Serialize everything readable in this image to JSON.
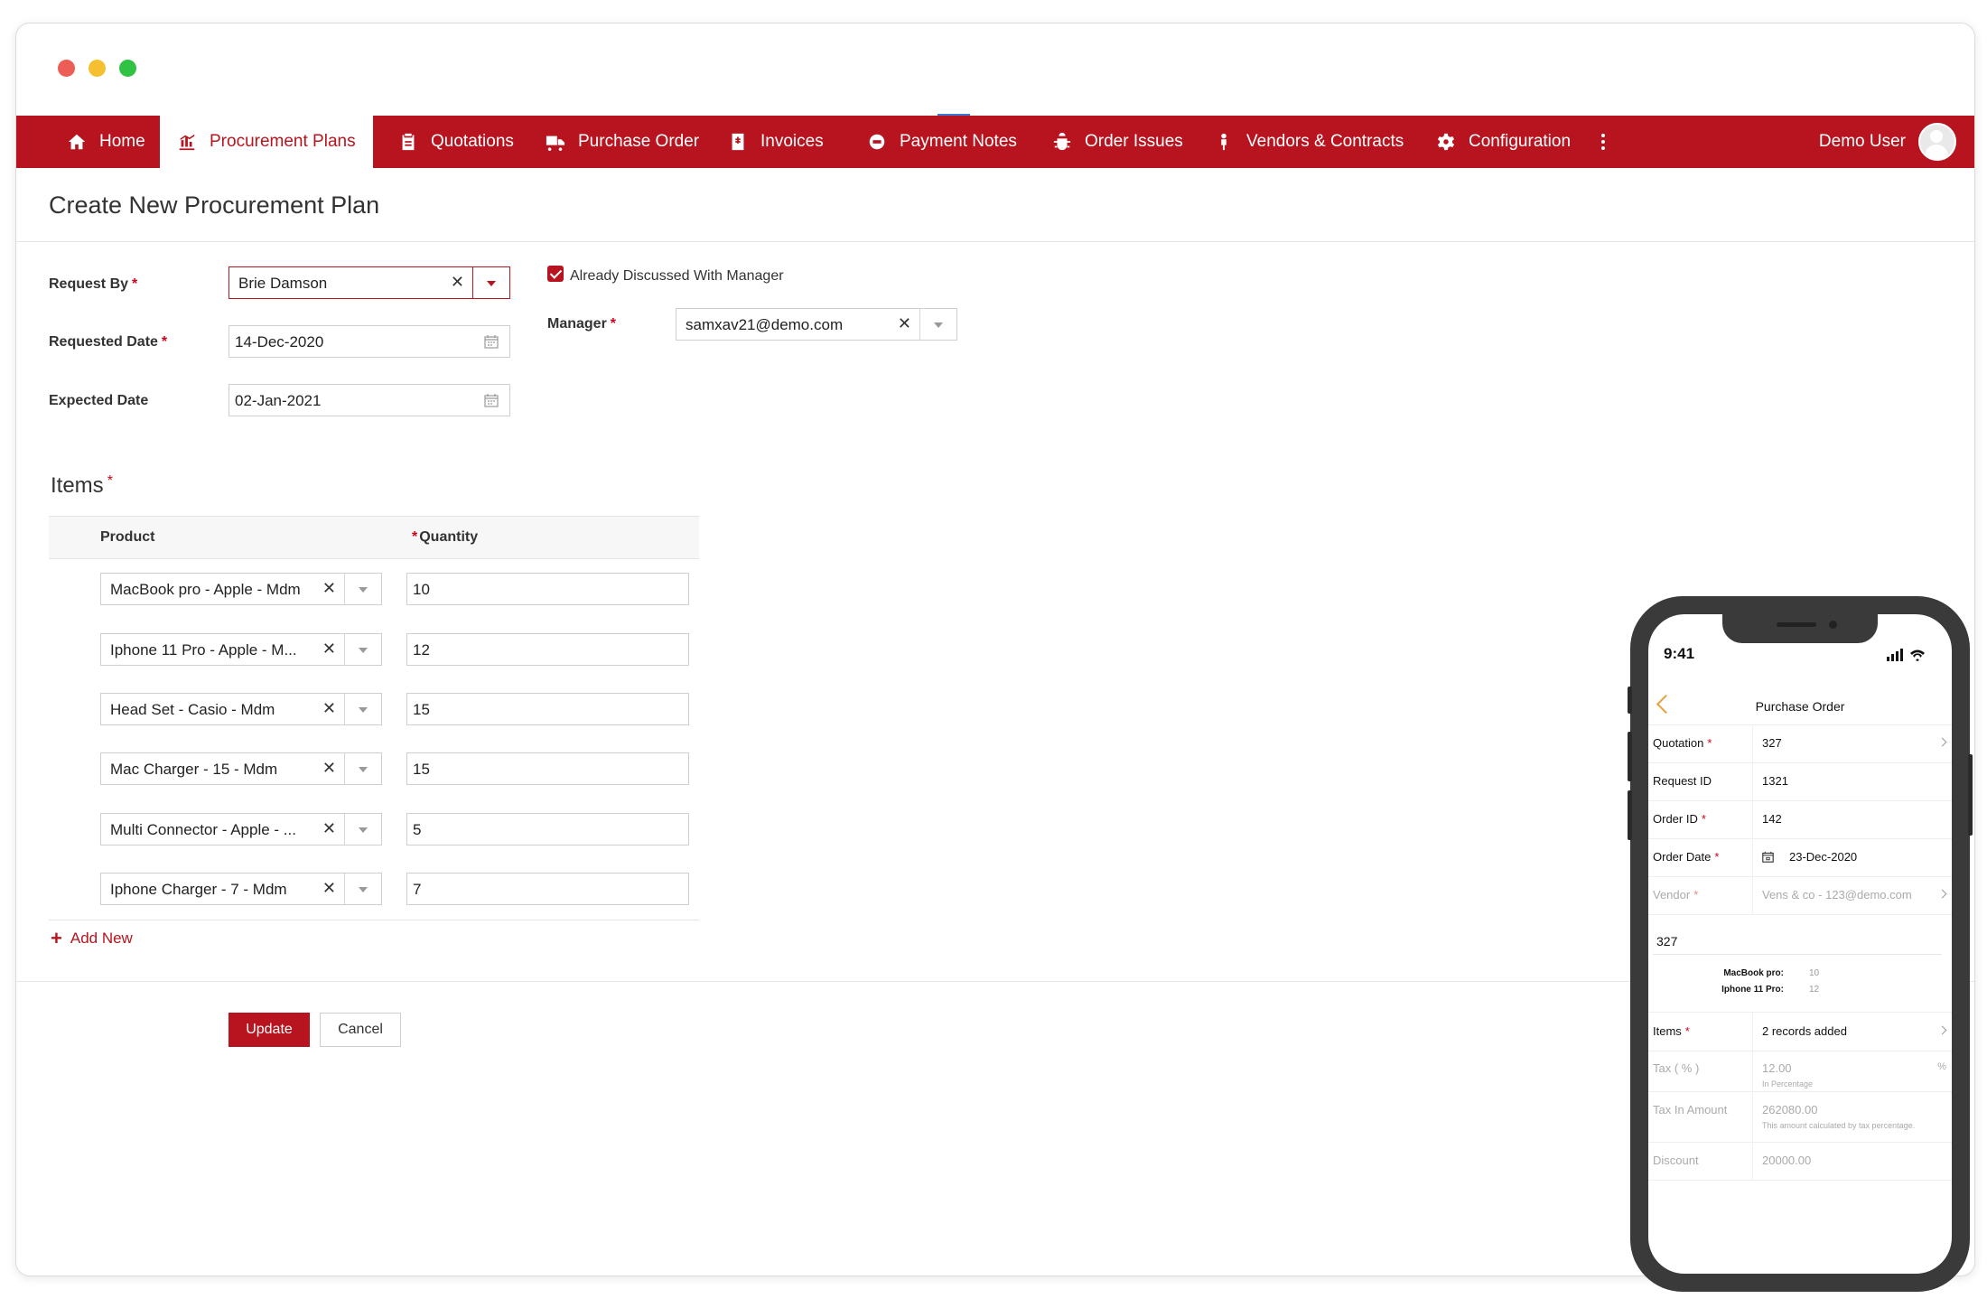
{
  "window": {
    "traffic_lights": [
      "#ed5d56",
      "#f5bf2f",
      "#31c244"
    ]
  },
  "colors": {
    "brand": "#b8141f",
    "accent_phone": "#e8a13a"
  },
  "nav": {
    "items": [
      {
        "label": "Home",
        "icon": "home-icon"
      },
      {
        "label": "Procurement Plans",
        "icon": "chart-icon",
        "active": true
      },
      {
        "label": "Quotations",
        "icon": "clipboard-icon"
      },
      {
        "label": "Purchase Order",
        "icon": "truck-icon"
      },
      {
        "label": "Invoices",
        "icon": "invoice-icon"
      },
      {
        "label": "Payment Notes",
        "icon": "payment-icon"
      },
      {
        "label": "Order Issues",
        "icon": "bug-icon"
      },
      {
        "label": "Vendors & Contracts",
        "icon": "person-icon"
      },
      {
        "label": "Configuration",
        "icon": "gear-icon"
      }
    ],
    "more_icon": "more-vertical-icon",
    "user_name": "Demo User"
  },
  "page": {
    "title": "Create New Procurement Plan"
  },
  "form": {
    "request_by": {
      "label": "Request By",
      "value": "Brie Damson"
    },
    "requested_date": {
      "label": "Requested Date",
      "value": "14-Dec-2020"
    },
    "expected_date": {
      "label": "Expected Date",
      "value": "02-Jan-2021"
    },
    "discussed": {
      "label": "Already Discussed With Manager",
      "checked": true
    },
    "manager": {
      "label": "Manager",
      "value": "samxav21@demo.com"
    }
  },
  "items": {
    "title": "Items",
    "col_product": "Product",
    "col_quantity": "Quantity",
    "rows": [
      {
        "product": "MacBook pro - Apple - Mdm",
        "quantity": "10"
      },
      {
        "product": "Iphone 11 Pro - Apple - M...",
        "quantity": "12"
      },
      {
        "product": "Head Set - Casio - Mdm",
        "quantity": "15"
      },
      {
        "product": "Mac Charger - 15 - Mdm",
        "quantity": "15"
      },
      {
        "product": "Multi Connector - Apple - ...",
        "quantity": "5"
      },
      {
        "product": "Iphone Charger - 7 - Mdm",
        "quantity": "7"
      }
    ],
    "add_new": "Add New"
  },
  "actions": {
    "update": "Update",
    "cancel": "Cancel"
  },
  "mobile": {
    "time": "9:41",
    "title": "Purchase Order",
    "quotation": {
      "label": "Quotation",
      "value": "327"
    },
    "request_id": {
      "label": "Request ID",
      "value": "1321"
    },
    "order_id": {
      "label": "Order ID",
      "value": "142"
    },
    "order_date": {
      "label": "Order Date",
      "value": "23-Dec-2020"
    },
    "vendor": {
      "label": "Vendor",
      "value": "Vens & co - 123@demo.com"
    },
    "quote_no": "327",
    "quote_items": [
      {
        "name": "MacBook pro:",
        "qty": "10"
      },
      {
        "name": "Iphone 11 Pro:",
        "qty": "12"
      }
    ],
    "items": {
      "label": "Items",
      "value": "2 records added"
    },
    "tax": {
      "label": "Tax ( % )",
      "value": "12.00",
      "unit": "%",
      "hint": "In Percentage"
    },
    "tax_amount": {
      "label": "Tax In Amount",
      "value": "262080.00",
      "hint": "This amount calculated by tax percentage."
    },
    "discount": {
      "label": "Discount",
      "value": "20000.00"
    }
  }
}
